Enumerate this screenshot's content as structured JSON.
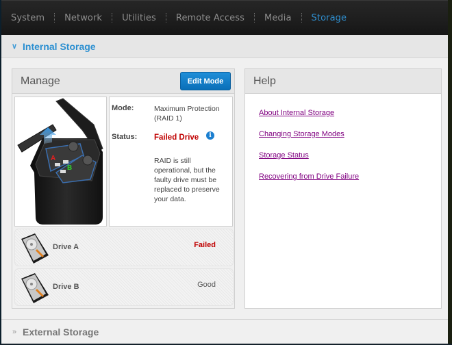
{
  "nav": {
    "items": [
      "System",
      "Network",
      "Utilities",
      "Remote Access",
      "Media",
      "Storage"
    ],
    "active": "Storage"
  },
  "internal_storage": {
    "title": "Internal Storage",
    "expanded_icon": "chevron-down-icon"
  },
  "manage": {
    "title": "Manage",
    "edit_button": "Edit Mode",
    "mode_label": "Mode:",
    "mode_value_line1": "Maximum Protection",
    "mode_value_line2": "(RAID 1)",
    "status_label": "Status:",
    "status_value": "Failed Drive",
    "status_color": "#c00000",
    "info_icon": "i",
    "status_description": "RAID is still operational, but the faulty drive must be replaced to preserve your data.",
    "image_labels": {
      "drive_a": "A",
      "drive_b": "B"
    },
    "drives": [
      {
        "name": "Drive A",
        "status": "Failed"
      },
      {
        "name": "Drive B",
        "status": "Good"
      }
    ]
  },
  "help": {
    "title": "Help",
    "links": [
      "About Internal Storage",
      "Changing Storage Modes",
      "Storage Status",
      "Recovering from Drive Failure"
    ]
  },
  "external_storage": {
    "title": "External Storage",
    "collapsed_icon": "chevron-right-icon"
  },
  "colors": {
    "accent": "#2b8fd1",
    "failed": "#c00000",
    "link": "#800080"
  }
}
